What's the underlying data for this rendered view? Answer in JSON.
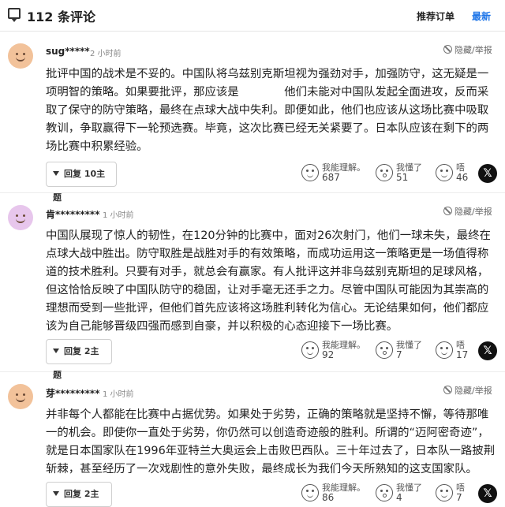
{
  "header": {
    "count_title": "112 条评论",
    "tab_recommended": "推荐订单",
    "tab_latest": "最新"
  },
  "comments": [
    {
      "username": "sug*****",
      "time": "2 小时前",
      "hide_label": "隐藏/举报",
      "avatar_color": "#f2c29a",
      "text": "批评中国的战术是不妥的。中国队将乌兹别克斯坦视为强劲对手，加强防守，这无疑是一项明智的策略。如果要批评，那应该是　　　　他们未能对中国队发起全面进攻，反而采取了保守的防守策略，最终在点球大战中失利。即便如此，他们也应该从这场比赛中吸取教训，争取赢得下一轮预选赛。毕竟，这次比赛已经无关紧要了。日本队应该在剩下的两场比赛中积累经验。",
      "reply_label": "回复 10主题",
      "reactions": [
        {
          "label": "我能理解。",
          "count": "687"
        },
        {
          "label": "我懂了",
          "count": "51"
        },
        {
          "label": "唔",
          "count": "46"
        }
      ]
    },
    {
      "username": "肯*********",
      "time": "1 小时前",
      "hide_label": "隐藏/举报",
      "avatar_color": "#e7c6ec",
      "text": "中国队展现了惊人的韧性，在120分钟的比赛中，面对26次射门，他们一球未失，最终在点球大战中胜出。防守取胜是战胜对手的有效策略，而成功运用这一策略更是一场值得称道的技术胜利。只要有对手，就总会有赢家。有人批评这并非乌兹别克斯坦的足球风格，但这恰恰反映了中国队防守的稳固，让对手毫无还手之力。尽管中国队可能因为其崇高的理想而受到一些批评，但他们首先应该将这场胜利转化为信心。无论结果如何，他们都应该为自己能够晋级四强而感到自豪，并以积极的心态迎接下一场比赛。",
      "reply_label": "回复 2主题",
      "reactions": [
        {
          "label": "我能理解。",
          "count": "92"
        },
        {
          "label": "我懂了",
          "count": "7"
        },
        {
          "label": "唔",
          "count": "17"
        }
      ]
    },
    {
      "username": "芽*********",
      "time": "1 小时前",
      "hide_label": "隐藏/举报",
      "avatar_color": "#f2c29a",
      "text": "并非每个人都能在比赛中占据优势。如果处于劣势，正确的策略就是坚持不懈，等待那唯一的机会。即使你一直处于劣势，你仍然可以创造奇迹般的胜利。所谓的“迈阿密奇迹”，就是日本国家队在1996年亚特兰大奥运会上击败巴西队。三十年过去了，日本队一路披荆斩棘，甚至经历了一次戏剧性的意外失败，最终成长为我们今天所熟知的这支国家队。",
      "reply_label": "回复 2主题",
      "reactions": [
        {
          "label": "我能理解。",
          "count": "86"
        },
        {
          "label": "我懂了",
          "count": "4"
        },
        {
          "label": "唔",
          "count": "7"
        }
      ]
    }
  ],
  "icons": [
    "chat-icon",
    "hide-icon",
    "understand-face-icon",
    "surprised-face-icon",
    "hmm-face-icon",
    "x-share-icon"
  ]
}
